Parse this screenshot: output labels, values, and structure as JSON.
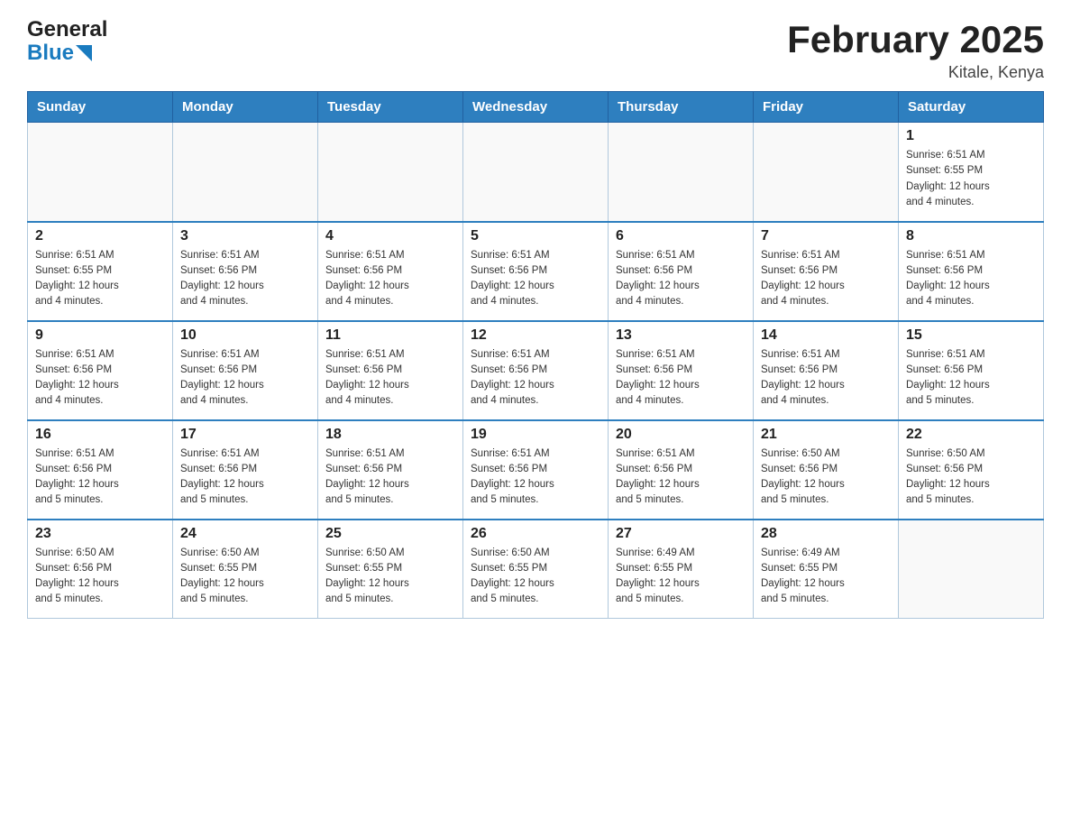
{
  "header": {
    "logo_general": "General",
    "logo_blue": "Blue",
    "title": "February 2025",
    "location": "Kitale, Kenya"
  },
  "weekdays": [
    "Sunday",
    "Monday",
    "Tuesday",
    "Wednesday",
    "Thursday",
    "Friday",
    "Saturday"
  ],
  "weeks": [
    [
      {
        "day": "",
        "info": ""
      },
      {
        "day": "",
        "info": ""
      },
      {
        "day": "",
        "info": ""
      },
      {
        "day": "",
        "info": ""
      },
      {
        "day": "",
        "info": ""
      },
      {
        "day": "",
        "info": ""
      },
      {
        "day": "1",
        "info": "Sunrise: 6:51 AM\nSunset: 6:55 PM\nDaylight: 12 hours\nand 4 minutes."
      }
    ],
    [
      {
        "day": "2",
        "info": "Sunrise: 6:51 AM\nSunset: 6:55 PM\nDaylight: 12 hours\nand 4 minutes."
      },
      {
        "day": "3",
        "info": "Sunrise: 6:51 AM\nSunset: 6:56 PM\nDaylight: 12 hours\nand 4 minutes."
      },
      {
        "day": "4",
        "info": "Sunrise: 6:51 AM\nSunset: 6:56 PM\nDaylight: 12 hours\nand 4 minutes."
      },
      {
        "day": "5",
        "info": "Sunrise: 6:51 AM\nSunset: 6:56 PM\nDaylight: 12 hours\nand 4 minutes."
      },
      {
        "day": "6",
        "info": "Sunrise: 6:51 AM\nSunset: 6:56 PM\nDaylight: 12 hours\nand 4 minutes."
      },
      {
        "day": "7",
        "info": "Sunrise: 6:51 AM\nSunset: 6:56 PM\nDaylight: 12 hours\nand 4 minutes."
      },
      {
        "day": "8",
        "info": "Sunrise: 6:51 AM\nSunset: 6:56 PM\nDaylight: 12 hours\nand 4 minutes."
      }
    ],
    [
      {
        "day": "9",
        "info": "Sunrise: 6:51 AM\nSunset: 6:56 PM\nDaylight: 12 hours\nand 4 minutes."
      },
      {
        "day": "10",
        "info": "Sunrise: 6:51 AM\nSunset: 6:56 PM\nDaylight: 12 hours\nand 4 minutes."
      },
      {
        "day": "11",
        "info": "Sunrise: 6:51 AM\nSunset: 6:56 PM\nDaylight: 12 hours\nand 4 minutes."
      },
      {
        "day": "12",
        "info": "Sunrise: 6:51 AM\nSunset: 6:56 PM\nDaylight: 12 hours\nand 4 minutes."
      },
      {
        "day": "13",
        "info": "Sunrise: 6:51 AM\nSunset: 6:56 PM\nDaylight: 12 hours\nand 4 minutes."
      },
      {
        "day": "14",
        "info": "Sunrise: 6:51 AM\nSunset: 6:56 PM\nDaylight: 12 hours\nand 4 minutes."
      },
      {
        "day": "15",
        "info": "Sunrise: 6:51 AM\nSunset: 6:56 PM\nDaylight: 12 hours\nand 5 minutes."
      }
    ],
    [
      {
        "day": "16",
        "info": "Sunrise: 6:51 AM\nSunset: 6:56 PM\nDaylight: 12 hours\nand 5 minutes."
      },
      {
        "day": "17",
        "info": "Sunrise: 6:51 AM\nSunset: 6:56 PM\nDaylight: 12 hours\nand 5 minutes."
      },
      {
        "day": "18",
        "info": "Sunrise: 6:51 AM\nSunset: 6:56 PM\nDaylight: 12 hours\nand 5 minutes."
      },
      {
        "day": "19",
        "info": "Sunrise: 6:51 AM\nSunset: 6:56 PM\nDaylight: 12 hours\nand 5 minutes."
      },
      {
        "day": "20",
        "info": "Sunrise: 6:51 AM\nSunset: 6:56 PM\nDaylight: 12 hours\nand 5 minutes."
      },
      {
        "day": "21",
        "info": "Sunrise: 6:50 AM\nSunset: 6:56 PM\nDaylight: 12 hours\nand 5 minutes."
      },
      {
        "day": "22",
        "info": "Sunrise: 6:50 AM\nSunset: 6:56 PM\nDaylight: 12 hours\nand 5 minutes."
      }
    ],
    [
      {
        "day": "23",
        "info": "Sunrise: 6:50 AM\nSunset: 6:56 PM\nDaylight: 12 hours\nand 5 minutes."
      },
      {
        "day": "24",
        "info": "Sunrise: 6:50 AM\nSunset: 6:55 PM\nDaylight: 12 hours\nand 5 minutes."
      },
      {
        "day": "25",
        "info": "Sunrise: 6:50 AM\nSunset: 6:55 PM\nDaylight: 12 hours\nand 5 minutes."
      },
      {
        "day": "26",
        "info": "Sunrise: 6:50 AM\nSunset: 6:55 PM\nDaylight: 12 hours\nand 5 minutes."
      },
      {
        "day": "27",
        "info": "Sunrise: 6:49 AM\nSunset: 6:55 PM\nDaylight: 12 hours\nand 5 minutes."
      },
      {
        "day": "28",
        "info": "Sunrise: 6:49 AM\nSunset: 6:55 PM\nDaylight: 12 hours\nand 5 minutes."
      },
      {
        "day": "",
        "info": ""
      }
    ]
  ]
}
